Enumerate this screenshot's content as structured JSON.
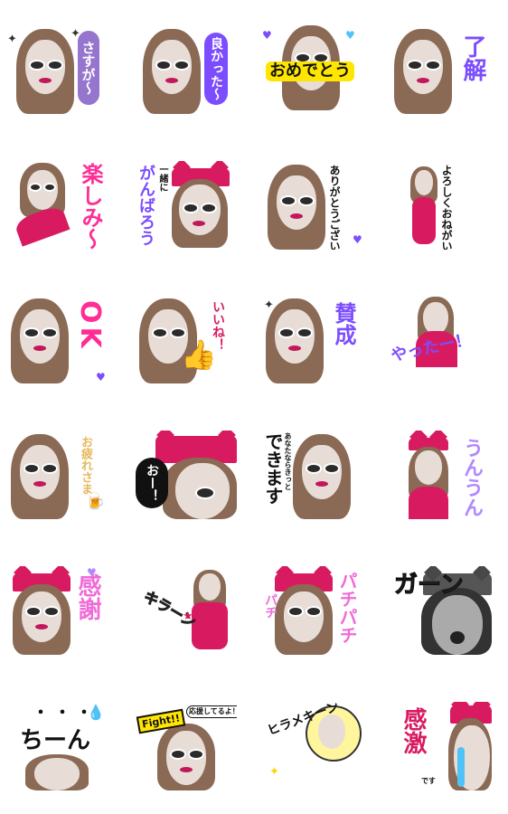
{
  "colors": {
    "magenta": "#d81b60",
    "purple": "#7c4dff",
    "lavender": "#b388ff",
    "pink": "#ff4fa3",
    "lightpink": "#f48fb1",
    "yellow": "#ffe600",
    "black": "#111111"
  },
  "stickers": [
    {
      "label": "さすが〜"
    },
    {
      "label": "良かった〜"
    },
    {
      "label": "おめでとう"
    },
    {
      "label": "了解"
    },
    {
      "label": "楽しみ〜"
    },
    {
      "label_small": "一緒に",
      "label": "がんばろう"
    },
    {
      "label": "ありがとうございます"
    },
    {
      "label": "よろしくおねがいします"
    },
    {
      "label": "OK"
    },
    {
      "label": "いいね！"
    },
    {
      "label": "賛成"
    },
    {
      "label": "やったー！"
    },
    {
      "label": "お疲れさま"
    },
    {
      "label": "おー！"
    },
    {
      "label_small": "あなたならきっと",
      "label": "できます"
    },
    {
      "label": "うんうん"
    },
    {
      "label": "感謝"
    },
    {
      "label": "キラーン"
    },
    {
      "label": "パチパチ",
      "label_small": "パチ"
    },
    {
      "label": "ガーン"
    },
    {
      "label_top": "・・・",
      "label": "ちーん"
    },
    {
      "label": "Fight!!",
      "label_small": "応援してるよ！"
    },
    {
      "label": "ヒラメキーン"
    },
    {
      "label": "感激",
      "label_small": "です"
    }
  ]
}
